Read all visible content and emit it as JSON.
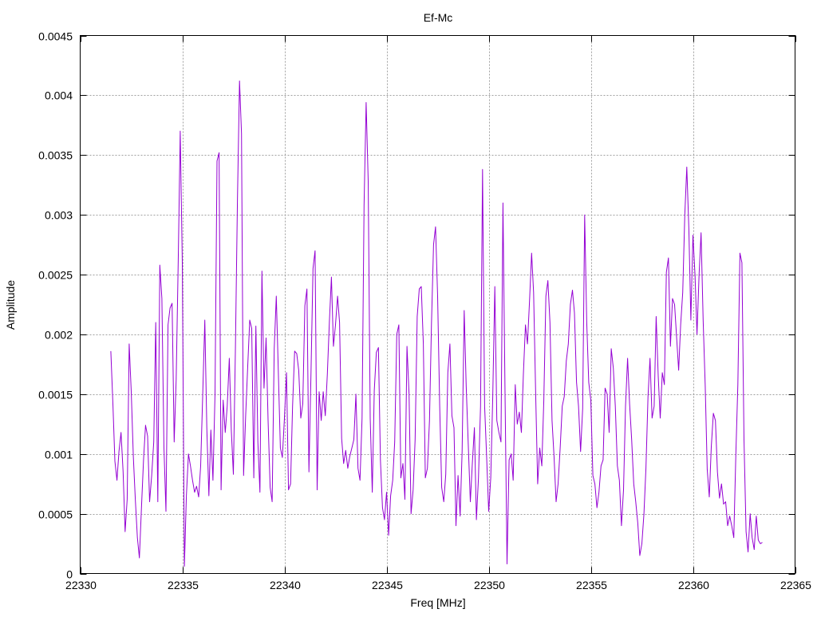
{
  "chart_data": {
    "type": "line",
    "title": "Ef-Mc",
    "xlabel": "Freq [MHz]",
    "ylabel": "Amplitude",
    "xlim": [
      22330,
      22365
    ],
    "ylim": [
      0,
      0.0045
    ],
    "xticks": [
      22330,
      22335,
      22340,
      22345,
      22350,
      22355,
      22360,
      22365
    ],
    "xtick_labels": [
      "22330",
      "22335",
      "22340",
      "22345",
      "22350",
      "22355",
      "22360",
      "22365"
    ],
    "yticks": [
      0,
      0.0005,
      0.001,
      0.0015,
      0.002,
      0.0025,
      0.003,
      0.0035,
      0.004,
      0.0045
    ],
    "ytick_labels": [
      "0",
      "0.0005",
      "0.001",
      "0.0015",
      "0.002",
      "0.0025",
      "0.003",
      "0.0035",
      "0.004",
      "0.0045"
    ],
    "grid": true,
    "legend": "none",
    "series": [
      {
        "color": "#9400d3",
        "x": [
          22331.5,
          22331.6,
          22331.7,
          22331.8,
          22331.9,
          22332.0,
          22332.1,
          22332.2,
          22332.3,
          22332.4,
          22332.5,
          22332.6,
          22332.7,
          22332.8,
          22332.9,
          22333.0,
          22333.1,
          22333.2,
          22333.3,
          22333.4,
          22333.5,
          22333.6,
          22333.7,
          22333.8,
          22333.9,
          22334.0,
          22334.1,
          22334.2,
          22334.3,
          22334.4,
          22334.5,
          22334.6,
          22334.7,
          22334.8,
          22334.9,
          22335.0,
          22335.1,
          22335.2,
          22335.3,
          22335.4,
          22335.5,
          22335.6,
          22335.7,
          22335.8,
          22335.9,
          22336.0,
          22336.1,
          22336.2,
          22336.3,
          22336.4,
          22336.5,
          22336.6,
          22336.7,
          22336.8,
          22336.9,
          22337.0,
          22337.1,
          22337.2,
          22337.3,
          22337.4,
          22337.5,
          22337.6,
          22337.7,
          22337.8,
          22337.9,
          22338.0,
          22338.1,
          22338.2,
          22338.3,
          22338.4,
          22338.5,
          22338.6,
          22338.7,
          22338.8,
          22338.9,
          22339.0,
          22339.1,
          22339.2,
          22339.3,
          22339.4,
          22339.5,
          22339.6,
          22339.7,
          22339.8,
          22339.9,
          22340.0,
          22340.1,
          22340.2,
          22340.3,
          22340.4,
          22340.5,
          22340.6,
          22340.7,
          22340.8,
          22340.9,
          22341.0,
          22341.1,
          22341.2,
          22341.3,
          22341.4,
          22341.5,
          22341.6,
          22341.7,
          22341.8,
          22341.9,
          22342.0,
          22342.1,
          22342.2,
          22342.3,
          22342.4,
          22342.5,
          22342.6,
          22342.7,
          22342.8,
          22342.9,
          22343.0,
          22343.1,
          22343.2,
          22343.3,
          22343.4,
          22343.5,
          22343.6,
          22343.7,
          22343.8,
          22343.9,
          22344.0,
          22344.1,
          22344.2,
          22344.3,
          22344.4,
          22344.5,
          22344.6,
          22344.7,
          22344.8,
          22344.9,
          22345.0,
          22345.1,
          22345.2,
          22345.3,
          22345.4,
          22345.5,
          22345.6,
          22345.7,
          22345.8,
          22345.9,
          22346.0,
          22346.1,
          22346.2,
          22346.3,
          22346.4,
          22346.5,
          22346.6,
          22346.7,
          22346.8,
          22346.9,
          22347.0,
          22347.1,
          22347.2,
          22347.3,
          22347.4,
          22347.5,
          22347.6,
          22347.7,
          22347.8,
          22347.9,
          22348.0,
          22348.1,
          22348.2,
          22348.3,
          22348.4,
          22348.5,
          22348.6,
          22348.7,
          22348.8,
          22348.9,
          22349.0,
          22349.1,
          22349.2,
          22349.3,
          22349.4,
          22349.5,
          22349.6,
          22349.7,
          22349.8,
          22349.9,
          22350.0,
          22350.1,
          22350.2,
          22350.3,
          22350.4,
          22350.5,
          22350.6,
          22350.7,
          22350.8,
          22350.9,
          22351.0,
          22351.1,
          22351.2,
          22351.3,
          22351.4,
          22351.5,
          22351.6,
          22351.7,
          22351.8,
          22351.9,
          22352.0,
          22352.1,
          22352.2,
          22352.3,
          22352.4,
          22352.5,
          22352.6,
          22352.7,
          22352.8,
          22352.9,
          22353.0,
          22353.1,
          22353.2,
          22353.3,
          22353.4,
          22353.5,
          22353.6,
          22353.7,
          22353.8,
          22353.9,
          22354.0,
          22354.1,
          22354.2,
          22354.3,
          22354.4,
          22354.5,
          22354.6,
          22354.7,
          22354.8,
          22354.9,
          22355.0,
          22355.1,
          22355.2,
          22355.3,
          22355.4,
          22355.5,
          22355.6,
          22355.7,
          22355.8,
          22355.9,
          22356.0,
          22356.1,
          22356.2,
          22356.3,
          22356.4,
          22356.5,
          22356.6,
          22356.7,
          22356.8,
          22356.9,
          22357.0,
          22357.1,
          22357.2,
          22357.3,
          22357.4,
          22357.5,
          22357.6,
          22357.7,
          22357.8,
          22357.9,
          22358.0,
          22358.1,
          22358.2,
          22358.3,
          22358.4,
          22358.5,
          22358.6,
          22358.7,
          22358.8,
          22358.9,
          22359.0,
          22359.1,
          22359.2,
          22359.3,
          22359.4,
          22359.5,
          22359.6,
          22359.7,
          22359.8,
          22359.9,
          22360.0,
          22360.1,
          22360.2,
          22360.3,
          22360.4,
          22360.5,
          22360.6,
          22360.7,
          22360.8,
          22360.9,
          22361.0,
          22361.1,
          22361.2,
          22361.3,
          22361.4,
          22361.5,
          22361.6,
          22361.7,
          22361.8,
          22361.9,
          22362.0,
          22362.1,
          22362.2,
          22362.3,
          22362.4,
          22362.5,
          22362.6,
          22362.7,
          22362.8,
          22362.9,
          22363.0,
          22363.1,
          22363.2,
          22363.3,
          22363.4
        ],
        "y": [
          0.00186,
          0.00142,
          0.00094,
          0.00078,
          0.00102,
          0.00118,
          0.00085,
          0.00035,
          0.00062,
          0.00192,
          0.00152,
          0.00098,
          0.00062,
          0.0003,
          0.00013,
          0.00055,
          0.00095,
          0.00124,
          0.00115,
          0.0006,
          0.00082,
          0.0011,
          0.0021,
          0.0006,
          0.00258,
          0.0023,
          0.00105,
          0.00052,
          0.00208,
          0.00222,
          0.00226,
          0.0011,
          0.00162,
          0.00262,
          0.0037,
          0.0026,
          6e-05,
          0.00065,
          0.001,
          0.0009,
          0.00078,
          0.00068,
          0.00073,
          0.00064,
          0.0009,
          0.0015,
          0.00212,
          0.00122,
          0.00065,
          0.0012,
          0.00078,
          0.0015,
          0.00345,
          0.00352,
          0.0007,
          0.00145,
          0.00118,
          0.0014,
          0.0018,
          0.0012,
          0.00083,
          0.0019,
          0.00312,
          0.00412,
          0.00368,
          0.00082,
          0.00132,
          0.00172,
          0.00212,
          0.00205,
          0.0008,
          0.00207,
          0.0011,
          0.00068,
          0.00253,
          0.00155,
          0.00197,
          0.00128,
          0.00072,
          0.0006,
          0.00188,
          0.00232,
          0.0017,
          0.00105,
          0.00097,
          0.0013,
          0.00168,
          0.0007,
          0.00075,
          0.0014,
          0.00186,
          0.00184,
          0.0017,
          0.0013,
          0.00142,
          0.00224,
          0.00238,
          0.00085,
          0.00168,
          0.00255,
          0.0027,
          0.0007,
          0.00152,
          0.00128,
          0.00152,
          0.00132,
          0.00167,
          0.0021,
          0.00248,
          0.0019,
          0.00208,
          0.00232,
          0.0021,
          0.00113,
          0.00092,
          0.00103,
          0.00088,
          0.00098,
          0.00105,
          0.00112,
          0.0015,
          0.00088,
          0.00078,
          0.0013,
          0.00308,
          0.00394,
          0.00328,
          0.0013,
          0.00068,
          0.00153,
          0.00185,
          0.00189,
          0.00095,
          0.00055,
          0.00045,
          0.00068,
          0.00032,
          0.00065,
          0.00078,
          0.0011,
          0.002,
          0.00208,
          0.0008,
          0.00092,
          0.00062,
          0.0019,
          0.0015,
          0.0005,
          0.0007,
          0.00112,
          0.00215,
          0.00238,
          0.0024,
          0.00192,
          0.0008,
          0.00088,
          0.00128,
          0.00209,
          0.00275,
          0.0029,
          0.00232,
          0.0014,
          0.00072,
          0.0006,
          0.00083,
          0.00168,
          0.00192,
          0.00132,
          0.00122,
          0.0004,
          0.00082,
          0.00048,
          0.00102,
          0.0022,
          0.00157,
          0.00108,
          0.0006,
          0.00092,
          0.00122,
          0.00045,
          0.0008,
          0.0014,
          0.00338,
          0.0014,
          0.00098,
          0.00052,
          0.0008,
          0.00148,
          0.0024,
          0.00128,
          0.00118,
          0.0011,
          0.0031,
          0.0015,
          8e-05,
          0.00095,
          0.001,
          0.00078,
          0.00158,
          0.00125,
          0.00135,
          0.00118,
          0.00167,
          0.00208,
          0.00192,
          0.00228,
          0.00268,
          0.00235,
          0.0015,
          0.00075,
          0.00105,
          0.0009,
          0.00145,
          0.00232,
          0.00245,
          0.0021,
          0.00128,
          0.00098,
          0.0006,
          0.00075,
          0.00105,
          0.0014,
          0.00148,
          0.00178,
          0.00192,
          0.00225,
          0.00237,
          0.00218,
          0.0016,
          0.0014,
          0.00102,
          0.00138,
          0.003,
          0.0021,
          0.0016,
          0.00145,
          0.00082,
          0.00075,
          0.00055,
          0.00068,
          0.0009,
          0.00095,
          0.00155,
          0.0015,
          0.00118,
          0.00188,
          0.00172,
          0.0014,
          0.0009,
          0.00078,
          0.0004,
          0.0007,
          0.0014,
          0.0018,
          0.00142,
          0.00112,
          0.00075,
          0.0006,
          0.00042,
          0.00015,
          0.00025,
          0.0005,
          0.00088,
          0.00148,
          0.0018,
          0.0013,
          0.0014,
          0.00215,
          0.00165,
          0.0013,
          0.00168,
          0.00158,
          0.00252,
          0.00264,
          0.0019,
          0.0023,
          0.00225,
          0.00198,
          0.0017,
          0.00208,
          0.00235,
          0.003,
          0.0034,
          0.00288,
          0.00212,
          0.00283,
          0.0025,
          0.002,
          0.0025,
          0.00285,
          0.00212,
          0.00157,
          0.00087,
          0.00064,
          0.00106,
          0.00134,
          0.00128,
          0.00085,
          0.00063,
          0.00075,
          0.00058,
          0.0006,
          0.0004,
          0.00048,
          0.0004,
          0.0003,
          0.001,
          0.00158,
          0.00268,
          0.0026,
          0.00112,
          0.00035,
          0.00018,
          0.0005,
          0.0003,
          0.0002,
          0.00048,
          0.00028,
          0.00025,
          0.00026
        ]
      }
    ]
  }
}
